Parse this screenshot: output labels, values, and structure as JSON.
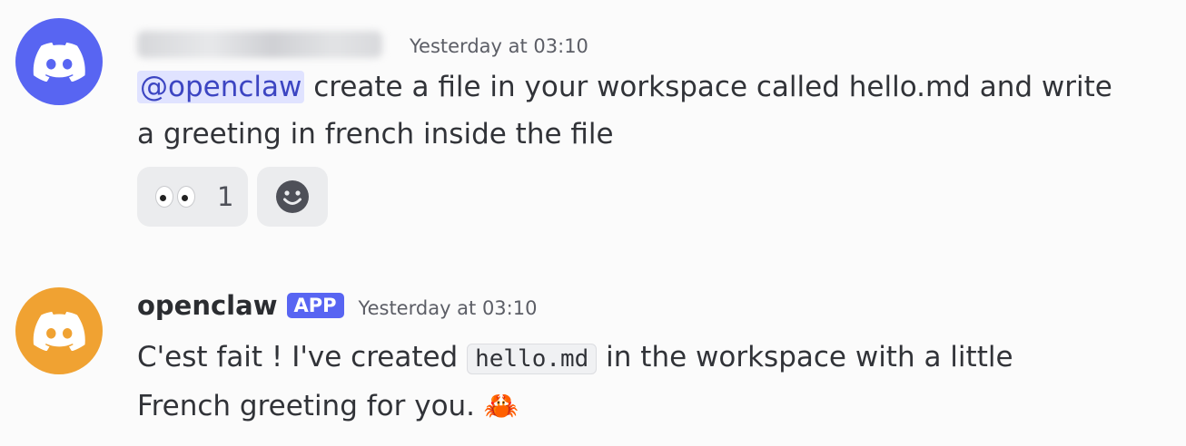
{
  "messages": [
    {
      "author_blurred": true,
      "timestamp": "Yesterday at 03:10",
      "mention": "@openclaw",
      "text_line1": " create a file in your workspace called hello.md and write",
      "text_line2": "a greeting in french inside the file",
      "avatar_color": "#5865f2",
      "avatar_icon": "discord-logo-icon",
      "reactions": [
        {
          "emoji": "eyes",
          "count": "1"
        }
      ],
      "add_reaction_icon": "smiley-face-icon"
    },
    {
      "author": "openclaw",
      "badge": "APP",
      "timestamp": "Yesterday at 03:10",
      "text_pre": "C'est fait ! I've created ",
      "code": "hello.md",
      "text_post": " in the workspace with a little",
      "text_line2": "French greeting for you. ",
      "emoji": "🦀",
      "avatar_color": "#f0a232",
      "avatar_icon": "discord-logo-icon"
    }
  ]
}
